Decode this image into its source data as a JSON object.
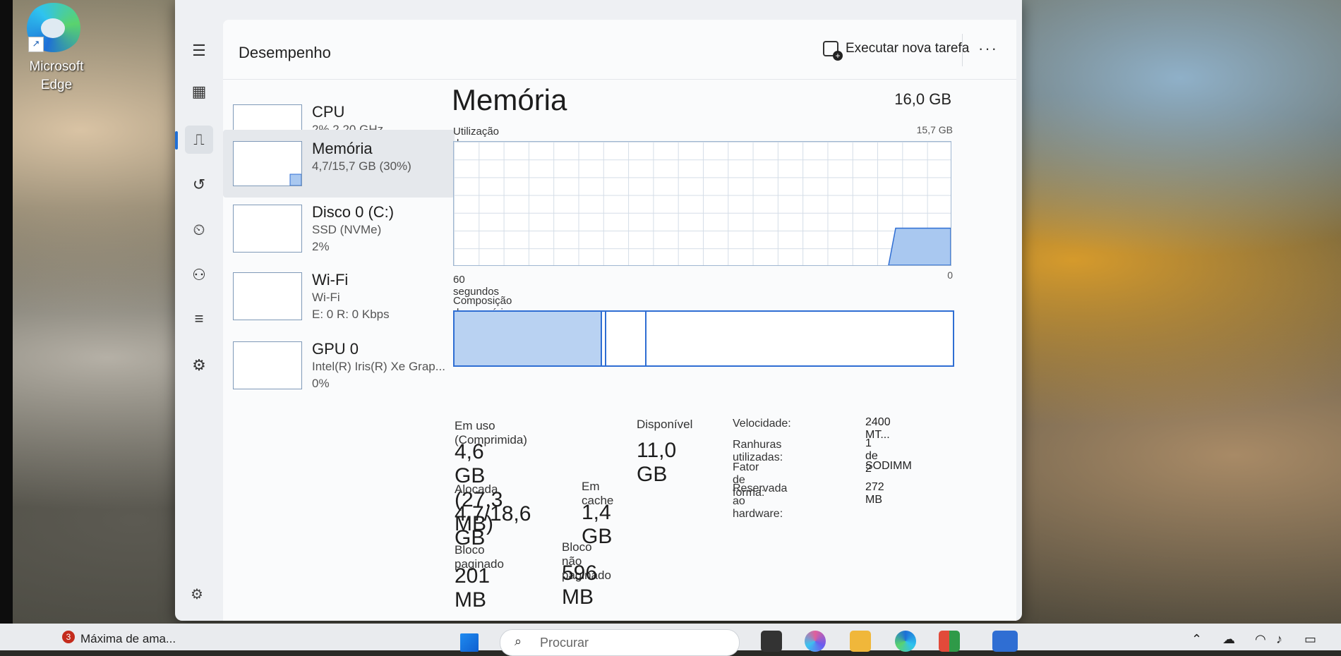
{
  "desktop": {
    "edge_label": "Microsoft Edge"
  },
  "window": {
    "section_title": "Desempenho",
    "run_task_label": "Executar nova tarefa",
    "more_label": "···"
  },
  "perf_list": [
    {
      "name": "CPU",
      "sub1": "2%  2,20 GHz",
      "sub2": ""
    },
    {
      "name": "Memória",
      "sub1": "4,7/15,7 GB (30%)",
      "sub2": ""
    },
    {
      "name": "Disco 0 (C:)",
      "sub1": "SSD (NVMe)",
      "sub2": "2%"
    },
    {
      "name": "Wi-Fi",
      "sub1": "Wi-Fi",
      "sub2": "E: 0  R: 0 Kbps"
    },
    {
      "name": "GPU 0",
      "sub1": "Intel(R) Iris(R) Xe Grap...",
      "sub2": "0%"
    }
  ],
  "memory": {
    "title": "Memória",
    "total": "16,0 GB",
    "usage_label": "Utilização da memória",
    "usage_max": "15,7 GB",
    "time_label": "60 segundos",
    "zero_label": "0",
    "composition_label": "Composição da memória",
    "current_usage_fraction": 0.3,
    "composition": {
      "in_use": 4.6,
      "modified": 0.1,
      "standby": 1.4,
      "free": 9.6,
      "total": 15.7
    }
  },
  "stats": {
    "in_use_label": "Em uso (Comprimida)",
    "in_use_value": "4,6 GB (27,3 MB)",
    "available_label": "Disponível",
    "available_value": "11,0 GB",
    "committed_label": "Alocada",
    "committed_value": "4,7/18,6 GB",
    "cached_label": "Em cache",
    "cached_value": "1,4 GB",
    "paged_label": "Bloco paginado",
    "paged_value": "201 MB",
    "nonpaged_label": "Bloco não paginado",
    "nonpaged_value": "596 MB"
  },
  "details": [
    {
      "key": "Velocidade:",
      "value": "2400 MT..."
    },
    {
      "key": "Ranhuras utilizadas:",
      "value": "1 de 2"
    },
    {
      "key": "Fator de forma:",
      "value": "SODIMM"
    },
    {
      "key": "Reservada ao hardware:",
      "value": "272 MB"
    }
  ],
  "taskbar": {
    "badge": "3",
    "app_label": "Máxima de ama...",
    "search_placeholder": "Procurar"
  },
  "colors": {
    "accent": "#2f6ed3",
    "graph_fill": "#a9c8f0",
    "window_bg": "#fafbfc"
  }
}
